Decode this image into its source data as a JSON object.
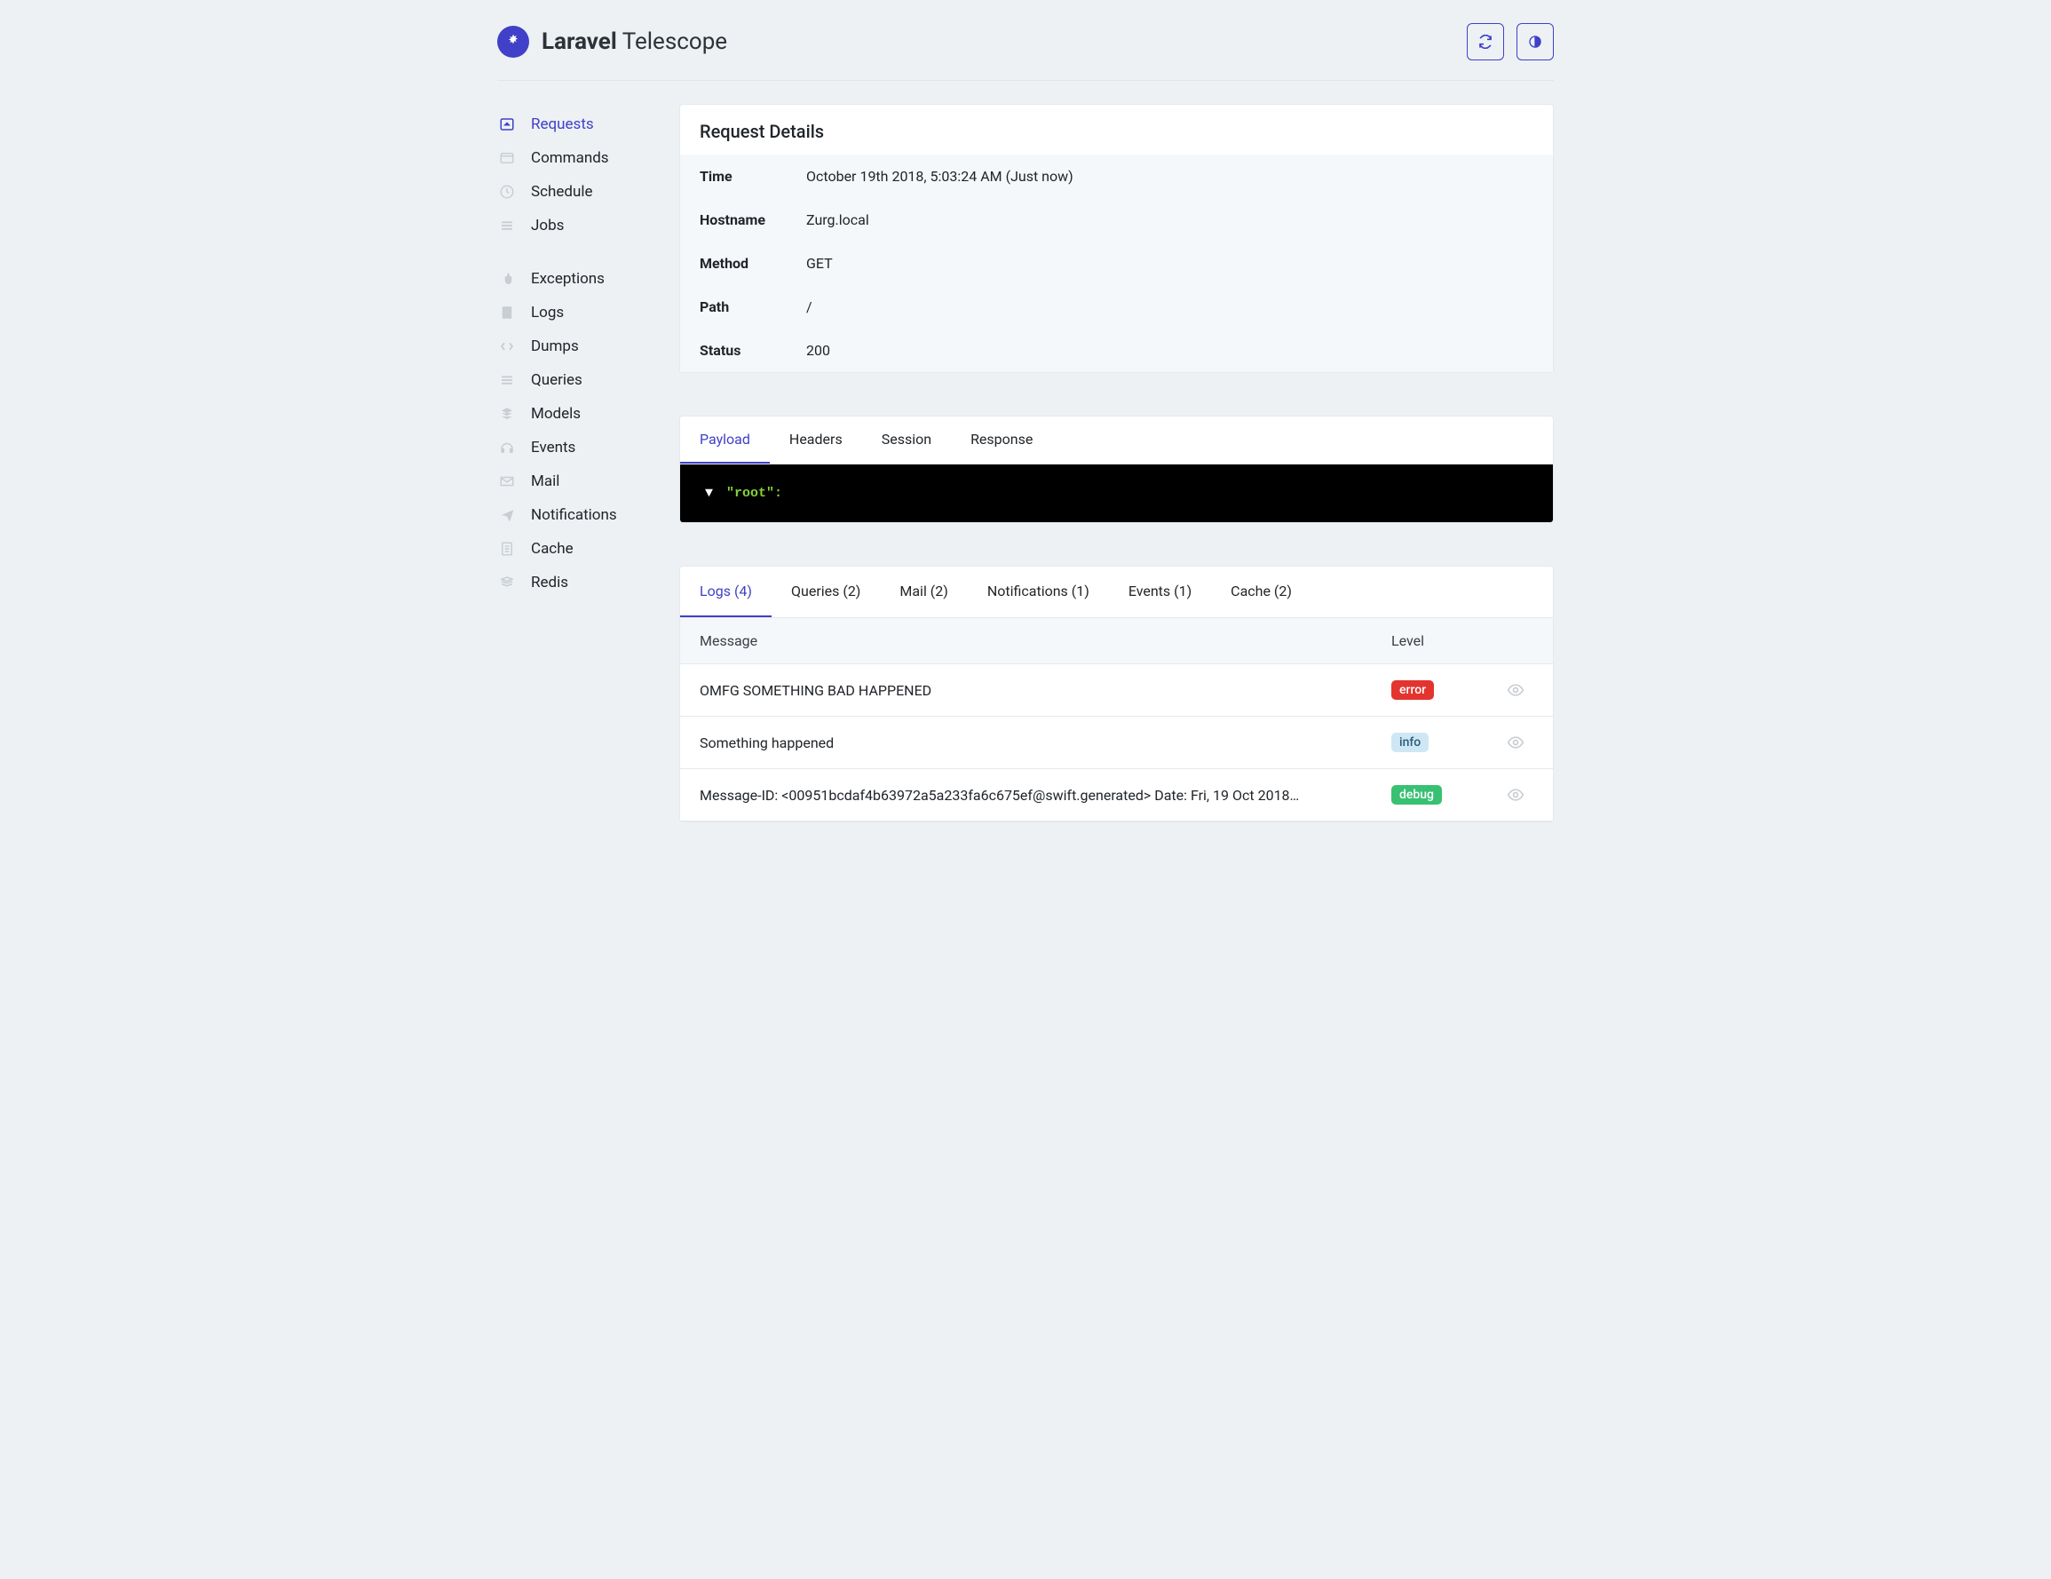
{
  "brand": {
    "bold": "Laravel",
    "light": "Telescope"
  },
  "sidebar": {
    "group1": [
      {
        "label": "Requests",
        "active": true
      },
      {
        "label": "Commands",
        "active": false
      },
      {
        "label": "Schedule",
        "active": false
      },
      {
        "label": "Jobs",
        "active": false
      }
    ],
    "group2": [
      {
        "label": "Exceptions"
      },
      {
        "label": "Logs"
      },
      {
        "label": "Dumps"
      },
      {
        "label": "Queries"
      },
      {
        "label": "Models"
      },
      {
        "label": "Events"
      },
      {
        "label": "Mail"
      },
      {
        "label": "Notifications"
      },
      {
        "label": "Cache"
      },
      {
        "label": "Redis"
      }
    ]
  },
  "details": {
    "title": "Request Details",
    "rows": [
      {
        "label": "Time",
        "value": "October 19th 2018, 5:03:24 AM (Just now)"
      },
      {
        "label": "Hostname",
        "value": "Zurg.local"
      },
      {
        "label": "Method",
        "value": "GET"
      },
      {
        "label": "Path",
        "value": "/"
      },
      {
        "label": "Status",
        "value": "200"
      }
    ]
  },
  "tabs": [
    {
      "label": "Payload",
      "active": true
    },
    {
      "label": "Headers",
      "active": false
    },
    {
      "label": "Session",
      "active": false
    },
    {
      "label": "Response",
      "active": false
    }
  ],
  "payload": {
    "root_key": "\"root\":"
  },
  "subtabs": [
    {
      "label": "Logs (4)",
      "active": true
    },
    {
      "label": "Queries (2)",
      "active": false
    },
    {
      "label": "Mail (2)",
      "active": false
    },
    {
      "label": "Notifications (1)",
      "active": false
    },
    {
      "label": "Events (1)",
      "active": false
    },
    {
      "label": "Cache (2)",
      "active": false
    }
  ],
  "log_table": {
    "headers": {
      "message": "Message",
      "level": "Level"
    },
    "rows": [
      {
        "message": "OMFG SOMETHING BAD HAPPENED",
        "level": "error",
        "level_class": "badge-error"
      },
      {
        "message": "Something happened",
        "level": "info",
        "level_class": "badge-info"
      },
      {
        "message": "Message-ID: <00951bcdaf4b63972a5a233fa6c675ef@swift.generated> Date: Fri, 19 Oct 2018…",
        "level": "debug",
        "level_class": "badge-debug"
      }
    ]
  }
}
